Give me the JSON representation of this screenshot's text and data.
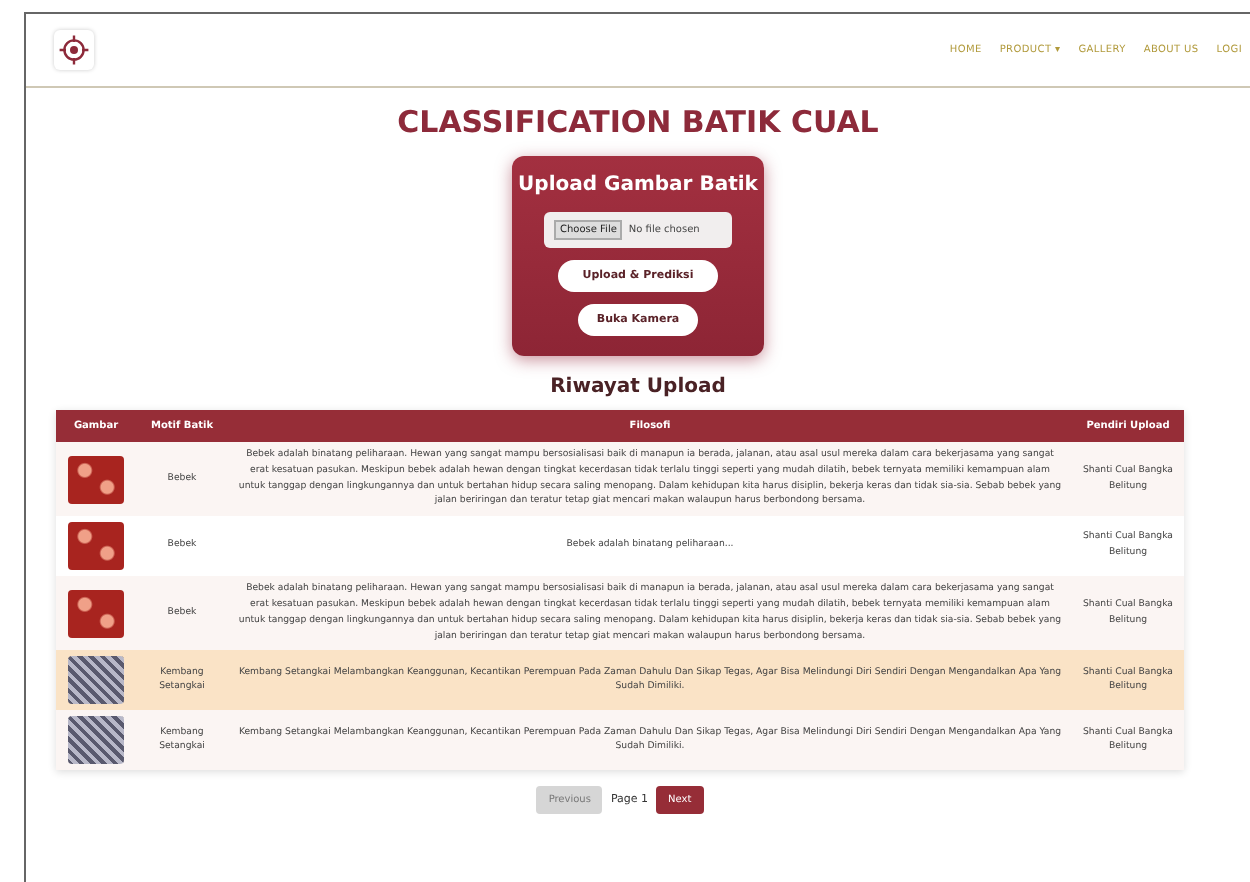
{
  "nav": {
    "items": [
      {
        "label": "HOME"
      },
      {
        "label": "PRODUCT ▾"
      },
      {
        "label": "GALLERY"
      },
      {
        "label": "ABOUT US"
      },
      {
        "label": "LOGI"
      }
    ]
  },
  "title": "CLASSIFICATION BATIK CUAL",
  "upload_card": {
    "title": "Upload Gambar Batik",
    "file_button": "Choose File",
    "file_status": "No file chosen",
    "predict_button": "Upload & Prediksi",
    "camera_button": "Buka Kamera"
  },
  "history": {
    "title": "Riwayat Upload",
    "columns": [
      "Gambar",
      "Motif Batik",
      "Filosofi",
      "Pendiri Upload"
    ],
    "rows": [
      {
        "kind": "floral",
        "motif": "Bebek",
        "filosofi": "Bebek adalah binatang peliharaan. Hewan yang sangat mampu bersosialisasi baik di manapun ia berada, jalanan, atau asal usul mereka dalam cara bekerjasama yang sangat erat kesatuan pasukan. Meskipun bebek adalah hewan dengan tingkat kecerdasan tidak terlalu tinggi seperti yang mudah dilatih, bebek ternyata memiliki kemampuan alam untuk tanggap dengan lingkungannya dan untuk bertahan hidup secara saling menopang. Dalam kehidupan kita harus disiplin, bekerja keras dan tidak sia-sia. Sebab bebek yang jalan beriringan dan teratur tetap giat mencari makan walaupun harus berbondong bersama.",
        "uploader": "Shanti Cual Bangka Belitung",
        "highlighted": false
      },
      {
        "kind": "floral",
        "motif": "Bebek",
        "filosofi": "Bebek adalah binatang peliharaan...",
        "uploader": "Shanti Cual Bangka Belitung",
        "highlighted": false
      },
      {
        "kind": "floral",
        "motif": "Bebek",
        "filosofi": "Bebek adalah binatang peliharaan. Hewan yang sangat mampu bersosialisasi baik di manapun ia berada, jalanan, atau asal usul mereka dalam cara bekerjasama yang sangat erat kesatuan pasukan. Meskipun bebek adalah hewan dengan tingkat kecerdasan tidak terlalu tinggi seperti yang mudah dilatih, bebek ternyata memiliki kemampuan alam untuk tanggap dengan lingkungannya dan untuk bertahan hidup secara saling menopang. Dalam kehidupan kita harus disiplin, bekerja keras dan tidak sia-sia. Sebab bebek yang jalan beriringan dan teratur tetap giat mencari makan walaupun harus berbondong bersama.",
        "uploader": "Shanti Cual Bangka Belitung",
        "highlighted": false
      },
      {
        "kind": "monochrome",
        "motif": "Kembang Setangkai",
        "filosofi": "Kembang Setangkai Melambangkan Keanggunan, Kecantikan Perempuan Pada Zaman Dahulu Dan Sikap Tegas, Agar Bisa Melindungi Diri Sendiri Dengan Mengandalkan Apa Yang Sudah Dimiliki.",
        "uploader": "Shanti Cual Bangka Belitung",
        "highlighted": true
      },
      {
        "kind": "monochrome",
        "motif": "Kembang Setangkai",
        "filosofi": "Kembang Setangkai Melambangkan Keanggunan, Kecantikan Perempuan Pada Zaman Dahulu Dan Sikap Tegas, Agar Bisa Melindungi Diri Sendiri Dengan Mengandalkan Apa Yang Sudah Dimiliki.",
        "uploader": "Shanti Cual Bangka Belitung",
        "highlighted": false
      }
    ]
  },
  "pagination": {
    "previous": {
      "label": "Previous",
      "disabled": true
    },
    "page": "Page 1",
    "next": {
      "label": "Next",
      "disabled": false
    }
  }
}
